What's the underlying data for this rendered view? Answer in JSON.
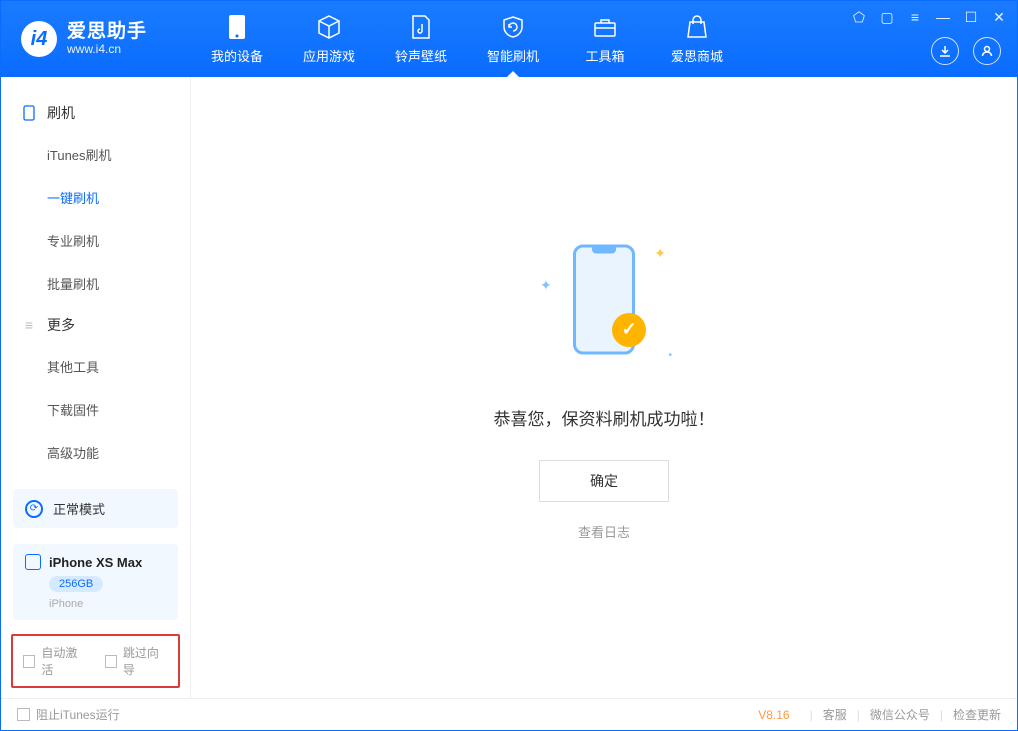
{
  "app": {
    "name": "爱思助手",
    "url": "www.i4.cn"
  },
  "tabs": [
    {
      "label": "我的设备"
    },
    {
      "label": "应用游戏"
    },
    {
      "label": "铃声壁纸"
    },
    {
      "label": "智能刷机",
      "active": true
    },
    {
      "label": "工具箱"
    },
    {
      "label": "爱思商城"
    }
  ],
  "sidebar": {
    "section1_title": "刷机",
    "items1": [
      {
        "label": "iTunes刷机"
      },
      {
        "label": "一键刷机",
        "active": true
      },
      {
        "label": "专业刷机"
      },
      {
        "label": "批量刷机"
      }
    ],
    "section2_title": "更多",
    "items2": [
      {
        "label": "其他工具"
      },
      {
        "label": "下载固件"
      },
      {
        "label": "高级功能"
      }
    ],
    "mode_label": "正常模式",
    "device": {
      "name": "iPhone XS Max",
      "capacity": "256GB",
      "model": "iPhone"
    },
    "cb1": "自动激活",
    "cb2": "跳过向导"
  },
  "main": {
    "success_msg": "恭喜您，保资料刷机成功啦！",
    "ok_label": "确定",
    "log_label": "查看日志"
  },
  "status": {
    "block_itunes": "阻止iTunes运行",
    "version": "V8.16",
    "links": [
      "客服",
      "微信公众号",
      "检查更新"
    ]
  }
}
